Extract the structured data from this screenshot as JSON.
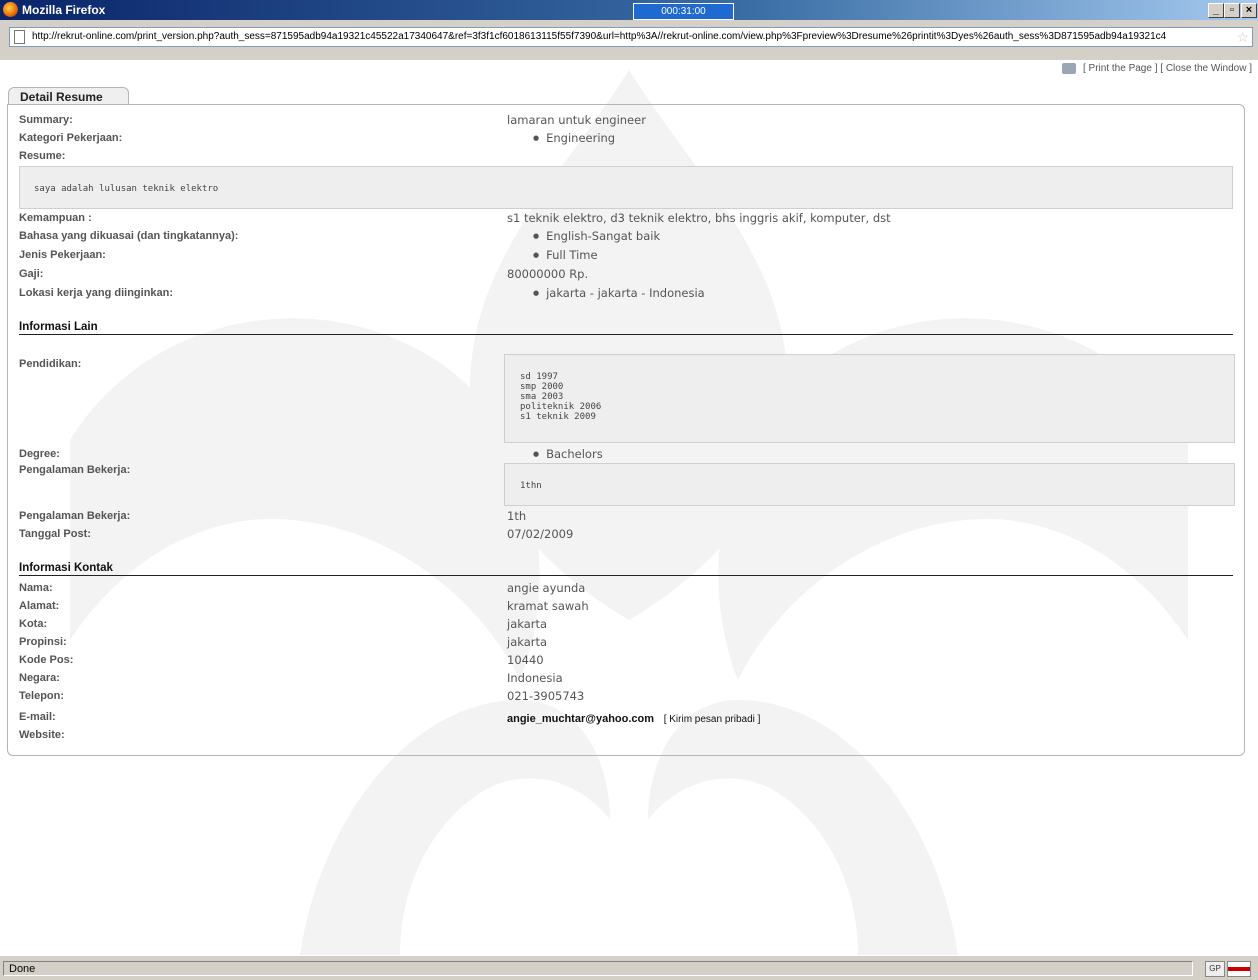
{
  "window": {
    "title": "Mozilla Firefox",
    "timer": "000:31:00",
    "controls": {
      "minimize": "_",
      "maximize": "▫",
      "close": "×"
    }
  },
  "address_bar": {
    "url": "http://rekrut-online.com/print_version.php?auth_sess=871595adb94a19321c45522a17340647&ref=3f3f1cf6018613115f55f7390&url=http%3A//rekrut-online.com/view.php%3Fpreview%3Dresume%26printit%3Dyes%26auth_sess%3D871595adb94a19321c4"
  },
  "print_links": {
    "print": "[ Print the Page ]",
    "close": "[ Close the Window ]"
  },
  "tab": {
    "label": "Detail Resume"
  },
  "resume": {
    "summary_label": "Summary:",
    "summary_value": "lamaran untuk engineer",
    "kategori_label": "Kategori Pekerjaan:",
    "kategori_value": "Engineering",
    "resume_label": "Resume:",
    "resume_text": "saya adalah lulusan teknik elektro",
    "kemampuan_label": "Kemampuan :",
    "kemampuan_value": "s1 teknik elektro, d3 teknik elektro, bhs inggris akif, komputer, dst",
    "bahasa_label": "Bahasa yang dikuasai (dan tingkatannya):",
    "bahasa_value": "English-Sangat baik",
    "jenis_label": "Jenis Pekerjaan:",
    "jenis_value": "Full Time",
    "gaji_label": "Gaji:",
    "gaji_value": "80000000 Rp.",
    "lokasi_label": "Lokasi kerja yang diinginkan:",
    "lokasi_value": "jakarta - jakarta - Indonesia"
  },
  "informasi_lain": {
    "heading": "Informasi Lain",
    "pendidikan_label": "Pendidikan:",
    "pendidikan_text": "sd 1997\nsmp 2000\nsma 2003\npoliteknik 2006\ns1 teknik 2009",
    "degree_label": "Degree:",
    "degree_value": "Bachelors",
    "pengalaman_label": "Pengalaman Bekerja:",
    "pengalaman_text": "1thn",
    "pengalaman2_label": "Pengalaman Bekerja:",
    "pengalaman2_value": "1th",
    "tanggal_label": "Tanggal Post:",
    "tanggal_value": "07/02/2009"
  },
  "informasi_kontak": {
    "heading": "Informasi Kontak",
    "nama_label": "Nama:",
    "nama_value": "angie ayunda",
    "alamat_label": "Alamat:",
    "alamat_value": "kramat sawah",
    "kota_label": "Kota:",
    "kota_value": "jakarta",
    "propinsi_label": "Propinsi:",
    "propinsi_value": "jakarta",
    "kodepos_label": "Kode Pos:",
    "kodepos_value": "10440",
    "negara_label": "Negara:",
    "negara_value": "Indonesia",
    "telepon_label": "Telepon:",
    "telepon_value": "021-3905743",
    "email_label": "E-mail:",
    "email_value": "angie_muchtar@yahoo.com",
    "kirim_label": "[ Kirim pesan pribadi ]",
    "website_label": "Website:"
  },
  "status_bar": {
    "text": "Done",
    "gp": "GP"
  },
  "icons": {
    "firefox": "firefox-icon",
    "page": "page-icon",
    "bookmark": "star-icon",
    "printer": "printer-icon",
    "flag": "flag-icon"
  },
  "colors": {
    "titlebar": "#0a246a",
    "chrome": "#d4d0c8",
    "box_bg": "#eeeeee"
  }
}
